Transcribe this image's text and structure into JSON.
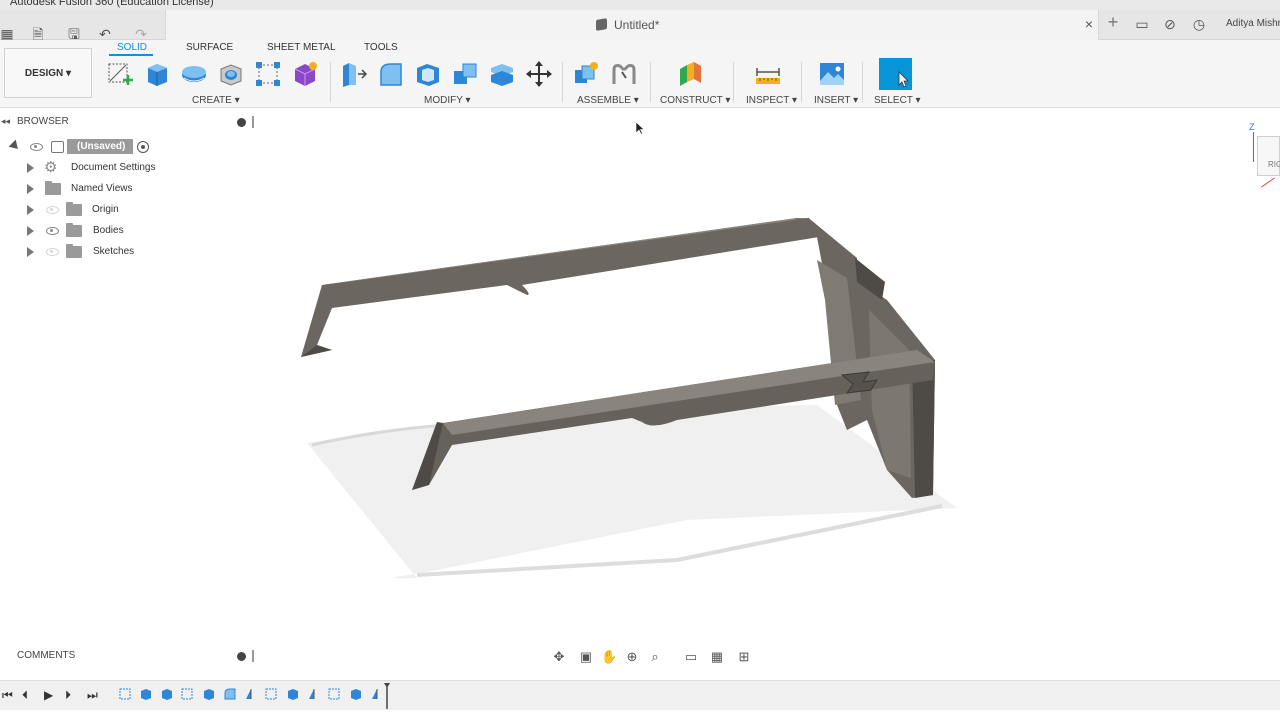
{
  "window": {
    "title": "Autodesk Fusion 360 (Education License)"
  },
  "document": {
    "title": "Untitled*",
    "close_glyph": "×"
  },
  "user": {
    "name": "Aditya Mishr"
  },
  "workspace": {
    "label": "DESIGN ▾"
  },
  "tabs": [
    "SOLID",
    "SURFACE",
    "SHEET METAL",
    "TOOLS"
  ],
  "groups": {
    "create": "CREATE ▾",
    "modify": "MODIFY ▾",
    "assemble": "ASSEMBLE ▾",
    "construct": "CONSTRUCT ▾",
    "inspect": "INSPECT ▾",
    "insert": "INSERT ▾",
    "select": "SELECT ▾"
  },
  "browser": {
    "title": "BROWSER",
    "root": "(Unsaved)",
    "items": [
      "Document Settings",
      "Named Views",
      "Origin",
      "Bodies",
      "Sketches"
    ]
  },
  "comments": {
    "title": "COMMENTS"
  },
  "viewcube": {
    "face": "RIG",
    "axis": "Z"
  },
  "colors": {
    "accent": "#0696d7",
    "model": "#6b6760",
    "model_dark": "#4e4b46"
  }
}
